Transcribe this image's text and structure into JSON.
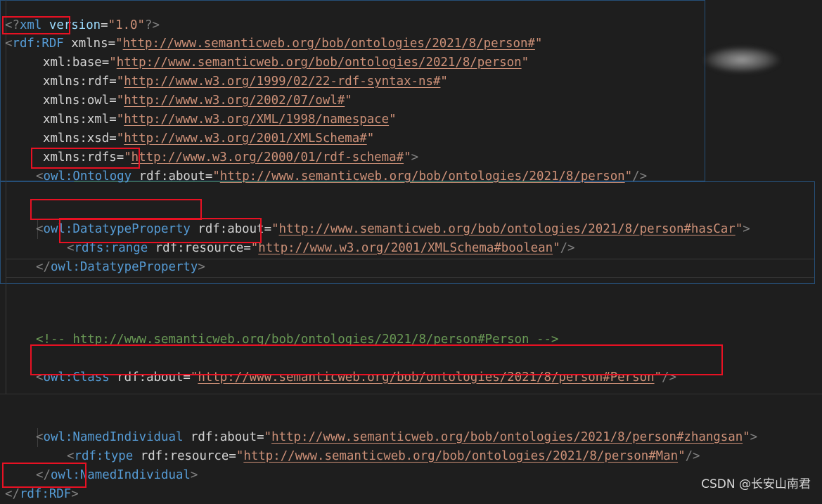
{
  "l1": {
    "p1": "<?",
    "n": "xml",
    "a": " version",
    "eq": "=",
    "q1": "\"",
    "v": "1.0",
    "q2": "\"",
    "p2": "?>"
  },
  "l2": {
    "lt": "<",
    "n": "rdf:RDF",
    "a": " xmlns",
    "eq": "=",
    "q1": "\"",
    "v": "http://www.semanticweb.org/bob/ontologies/2021/8/person#",
    "q2": "\""
  },
  "l3": {
    "a": "xml:base",
    "eq": "=",
    "q1": "\"",
    "v": "http://www.semanticweb.org/bob/ontologies/2021/8/person",
    "q2": "\""
  },
  "l4": {
    "a": "xmlns:rdf",
    "eq": "=",
    "q1": "\"",
    "v": "http://www.w3.org/1999/02/22-rdf-syntax-ns#",
    "q2": "\""
  },
  "l5": {
    "a": "xmlns:owl",
    "eq": "=",
    "q1": "\"",
    "v": "http://www.w3.org/2002/07/owl#",
    "q2": "\""
  },
  "l6": {
    "a": "xmlns:xml",
    "eq": "=",
    "q1": "\"",
    "v": "http://www.w3.org/XML/1998/namespace",
    "q2": "\""
  },
  "l7": {
    "a": "xmlns:xsd",
    "eq": "=",
    "q1": "\"",
    "v": "http://www.w3.org/2001/XMLSchema#",
    "q2": "\""
  },
  "l8": {
    "a": "xmlns:rdfs",
    "eq": "=",
    "q1": "\"",
    "v": "http://www.w3.org/2000/01/rdf-schema#",
    "q2": "\"",
    "gt": ">"
  },
  "l9": {
    "lt": "<",
    "n": "owl:Ontology",
    "a": " rdf:about",
    "eq": "=",
    "q1": "\"",
    "v": "http://www.semanticweb.org/bob/ontologies/2021/8/person",
    "q2": "\"",
    "end": "/>"
  },
  "l10": {
    "lt": "<",
    "n": "owl:DatatypeProperty",
    "a": " rdf:about",
    "eq": "=",
    "q1": "\"",
    "v": "http://www.semanticweb.org/bob/ontologies/2021/8/person#hasCar",
    "q2": "\"",
    "gt": ">"
  },
  "l11": {
    "lt": "<",
    "n": "rdfs:range",
    "a": " rdf:resource",
    "eq": "=",
    "q1": "\"",
    "v": "http://www.w3.org/2001/XMLSchema#boolean",
    "q2": "\"",
    "end": "/>"
  },
  "l12": {
    "lt": "</",
    "n": "owl:DatatypeProperty",
    "gt": ">"
  },
  "l13": {
    "open": "<!-- ",
    "url": "http://www.semanticweb.org/bob/ontologies/2021/8/person#Person",
    "close": " -->"
  },
  "l14": {
    "lt": "<",
    "n": "owl:Class",
    "a": " rdf:about",
    "eq": "=",
    "q1": "\"",
    "v": "http://www.semanticweb.org/bob/ontologies/2021/8/person#Person",
    "q2": "\"",
    "end": "/>"
  },
  "l15": {
    "lt": "<",
    "n": "owl:NamedIndividual",
    "a": " rdf:about",
    "eq": "=",
    "q1": "\"",
    "v": "http://www.semanticweb.org/bob/ontologies/2021/8/person#zhangsan",
    "q2": "\"",
    "gt": ">"
  },
  "l16": {
    "lt": "<",
    "n": "rdf:type",
    "a": " rdf:resource",
    "eq": "=",
    "q1": "\"",
    "v": "http://www.semanticweb.org/bob/ontologies/2021/8/person#Man",
    "q2": "\"",
    "end": "/>"
  },
  "l17": {
    "lt": "</",
    "n": "owl:NamedIndividual",
    "gt": ">"
  },
  "l18": {
    "lt": "</",
    "n": "rdf:RDF",
    "gt": ">"
  },
  "watermark": "CSDN @长安山南君",
  "colors": {
    "highlight_box": "#e81123",
    "tag": "#569cd6",
    "attr": "#9cdcfe",
    "string": "#ce9178",
    "comment": "#6a9955",
    "background": "#1e1e1e"
  }
}
